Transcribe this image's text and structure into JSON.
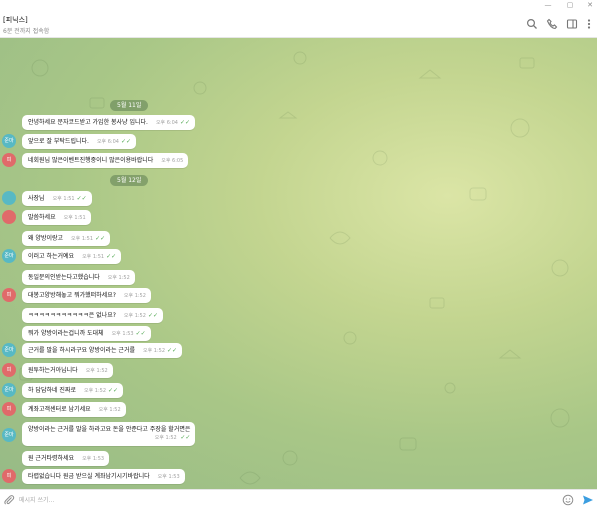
{
  "window": {
    "minimize_glyph": "—",
    "maximize_glyph": "▢",
    "close_glyph": "✕"
  },
  "header": {
    "title": "[피닉스]",
    "status": "6분 전까지 접속함",
    "icons": [
      "search-icon",
      "phone-icon",
      "sidebar-icon",
      "more-icon"
    ]
  },
  "chat": {
    "dates": [
      "5월 11일",
      "5월 12일"
    ],
    "messages": [
      {
        "avatar": "",
        "avatar_color": "",
        "text": "안녕하세요 문자코드받고 가입한 봉사냥 입니다.",
        "time": "오후 6:04",
        "read": "✓✓"
      },
      {
        "avatar": "준마",
        "avatar_color": "#58b9c4",
        "text": "앞으로 잘 부탁드립니다.",
        "time": "오후 6:04",
        "read": "✓✓"
      },
      {
        "avatar": "피",
        "avatar_color": "#e06a6a",
        "text": "네회원님 많은이벤트진행중이니 많은이용바랍니다",
        "time": "오후 6:05",
        "read": ""
      },
      {
        "avatar": "",
        "avatar_color": "",
        "text": "사장님",
        "time": "오후 1:51",
        "read": "✓✓"
      },
      {
        "avatar": "",
        "avatar_color": "",
        "text": "말씀하세요",
        "time": "오후 1:51",
        "read": ""
      },
      {
        "avatar": "",
        "avatar_color": "",
        "text": "왜 양방이랑고",
        "time": "오후 1:51",
        "read": "✓✓"
      },
      {
        "avatar": "준마",
        "avatar_color": "#58b9c4",
        "text": "이러고 하는거예요",
        "time": "오후 1:51",
        "read": "✓✓"
      },
      {
        "avatar": "",
        "avatar_color": "",
        "text": "동일문의인받는다고했습니다",
        "time": "오후 1:52",
        "read": ""
      },
      {
        "avatar": "피",
        "avatar_color": "#e06a6a",
        "text": "대봉고양방해놓고 뭐가했떠하세요?",
        "time": "오후 1:52",
        "read": ""
      },
      {
        "avatar": "",
        "avatar_color": "",
        "text": "ㅋㅋㅋㅋㅋㅋㅋㅋㅋㅋㅋ은 없나요?",
        "time": "오후 1:52",
        "read": "✓✓"
      },
      {
        "avatar": "",
        "avatar_color": "",
        "text": "뭐가 양방이라는겁니까 도대체",
        "time": "오후 1:53",
        "read": "✓✓"
      },
      {
        "avatar": "준마",
        "avatar_color": "#58b9c4",
        "text": "근거를 말을 하시라구요 양방이라는 근거를",
        "time": "오후 1:52",
        "read": "✓✓"
      },
      {
        "avatar": "피",
        "avatar_color": "#e06a6a",
        "text": "원투하는거아닙니다",
        "time": "오후 1:52",
        "read": ""
      },
      {
        "avatar": "준마",
        "avatar_color": "#58b9c4",
        "text": "하 답답하네 진짜로",
        "time": "오후 1:52",
        "read": "✓✓"
      },
      {
        "avatar": "피",
        "avatar_color": "#e06a6a",
        "text": "계좌고객센터로 남기세요",
        "time": "오후 1:52",
        "read": ""
      },
      {
        "avatar": "준마",
        "avatar_color": "#58b9c4",
        "text": "양방이라는 근거를 말을 하라고요 돈을 안준다고 주장을 할거면은",
        "time": "오후 1:52",
        "read": "✓✓"
      },
      {
        "avatar": "",
        "avatar_color": "",
        "text": "원 근거타령하세요",
        "time": "오후 1:53",
        "read": ""
      },
      {
        "avatar": "피",
        "avatar_color": "#e06a6a",
        "text": "타렵없습니다 원금 받으실 계좌남기시기바랍니다",
        "time": "오후 1:53",
        "read": ""
      }
    ]
  },
  "composer": {
    "placeholder": "메시지 쓰기...",
    "value": ""
  }
}
